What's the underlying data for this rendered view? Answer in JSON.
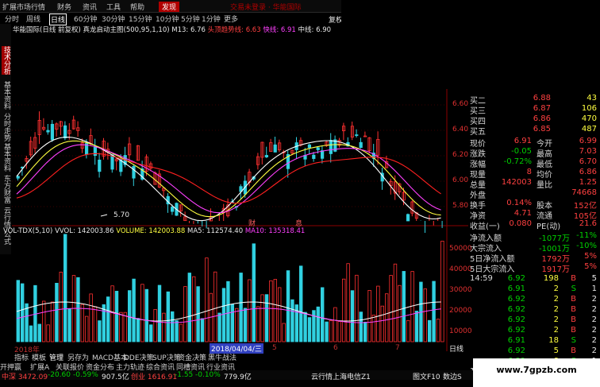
{
  "menubar": {
    "items": [
      "扩展市场行情",
      "财务",
      "资讯",
      "工具",
      "帮助",
      "发现"
    ],
    "center_text": "交易未登录 · 华能国际"
  },
  "periods": {
    "items": [
      "分时",
      "周线",
      "日线",
      "60分钟",
      "30分钟",
      "15分钟",
      "10分钟",
      "5分钟",
      "1分钟",
      "更多"
    ],
    "active": "日线"
  },
  "side_tabs": [
    "技术分析",
    "基本资料",
    "分时走势",
    "基本资料",
    "东方财富",
    "云行情",
    "公式"
  ],
  "info": {
    "stock": "华能国际(日线 前复权)",
    "indicator": "真龙启动主图(500,95,1,10)",
    "m13": "M13: 6.76",
    "m_dead": "头顶趋势线: 6.63",
    "m_fast": "快线: 6.91",
    "m_mid": "中线: 6.90",
    "side": "复权"
  },
  "low_label": "5.70",
  "fin_marks": [
    "财",
    "息"
  ],
  "price_ticks": [
    "6.60",
    "6.40",
    "6.20",
    "6.00",
    "5.80"
  ],
  "volume": {
    "title": "VOL-TDX(5,10)",
    "vvol": "VVOL: 142003.86",
    "volume_label": "VOLUME: 142003.88",
    "ma5": "MA5: 112574.40",
    "ma10": "MA10: 135318.41",
    "ticks": [
      "50000",
      "40000",
      "30000",
      "20000",
      "10000"
    ]
  },
  "quote": {
    "asks": [
      {
        "label": "买二",
        "price": "6.88",
        "vol": "43"
      },
      {
        "label": "买三",
        "price": "6.87",
        "vol": "106"
      },
      {
        "label": "买四",
        "price": "6.86",
        "vol": "470"
      },
      {
        "label": "买五",
        "price": "6.85",
        "vol": "487"
      }
    ],
    "stats": [
      {
        "l1": "现价",
        "v1": "6.91",
        "l2": "今开",
        "v2": "6.99"
      },
      {
        "l1": "涨跌",
        "v1": "-0.05",
        "l2": "最高",
        "v2": "7.03"
      },
      {
        "l1": "涨幅",
        "v1": "-0.72%",
        "l2": "最低",
        "v2": "6.70"
      },
      {
        "l1": "现量",
        "v1": "8",
        "l2": "均价",
        "v2": "6.86"
      },
      {
        "l1": "总量",
        "v1": "142003",
        "l2": "量比",
        "v2": "1.25"
      },
      {
        "l1": "外盘",
        "v1": "",
        "l2": "",
        "v2": "74668"
      },
      {
        "l1": "换手",
        "v1": "0.14%",
        "l2": "股本",
        "v2": "152亿"
      },
      {
        "l1": "净资",
        "v1": "4.71",
        "l2": "流通",
        "v2": "105亿"
      },
      {
        "l1": "收益(一)",
        "v1": "0.080",
        "l2": "PE(动)",
        "v2": "21.6"
      }
    ],
    "flows": [
      {
        "label": "净流入额",
        "v1": "-1077万",
        "v2": "-11%"
      },
      {
        "label": "大宗流入",
        "v1": "-1001万",
        "v2": "-10%"
      },
      {
        "label": "5日净流入额",
        "v1": "1792万",
        "v2": "5%"
      },
      {
        "label": "5日大宗流入",
        "v1": "1917万",
        "v2": "5%"
      }
    ],
    "ticks_time": "14:59",
    "ticks": [
      {
        "p": "6.92",
        "v": "198",
        "s": "B",
        "n": "5"
      },
      {
        "p": "6.91",
        "v": "2",
        "s": "S",
        "n": "1"
      },
      {
        "p": "6.92",
        "v": "2",
        "s": "B",
        "n": "2"
      },
      {
        "p": "6.92",
        "v": "2",
        "s": "B",
        "n": "2"
      },
      {
        "p": "6.92",
        "v": "2",
        "s": "B",
        "n": "2"
      },
      {
        "p": "6.92",
        "v": "2",
        "s": "B",
        "n": "2"
      },
      {
        "p": "6.91",
        "v": "18",
        "s": "S",
        "n": "2"
      },
      {
        "p": "6.92",
        "v": "5",
        "s": "B",
        "n": "2"
      },
      {
        "p": "6.89",
        "v": "8",
        "s": "S",
        "n": "1"
      }
    ],
    "ticks_end": "15:0"
  },
  "date_axis": {
    "start": "2018年",
    "cursor": "2018/04/04/三",
    "months": [
      "5",
      "6",
      "7"
    ]
  },
  "right_label": "日线",
  "bottom_tabs": [
    "指标",
    "模板",
    "管理",
    "另存为",
    "MACD基本",
    "DDE决策",
    "SUP决策",
    "资金决策",
    "黑牛战法"
  ],
  "bottom_tabs2": [
    "开押赢",
    "扩展A",
    "关联报价",
    "资金分布",
    "主力轨迹",
    "综合资讯",
    "同槽资讯",
    "行业资讯"
  ],
  "status": {
    "sh": "中深 3472.09",
    "sh_chg": "-20.60",
    "sh_pct": "-0.59%",
    "sh_amt": "907.5亿",
    "cy": "创业 1616.91",
    "cy_chg": "-1.55",
    "cy_pct": "-0.10%",
    "cy_amt": "779.9亿",
    "mid": "云行情上海电信Z1",
    "right1": "图文F10",
    "right2": "数边S"
  },
  "watermark": "www.7gpzb.com"
}
